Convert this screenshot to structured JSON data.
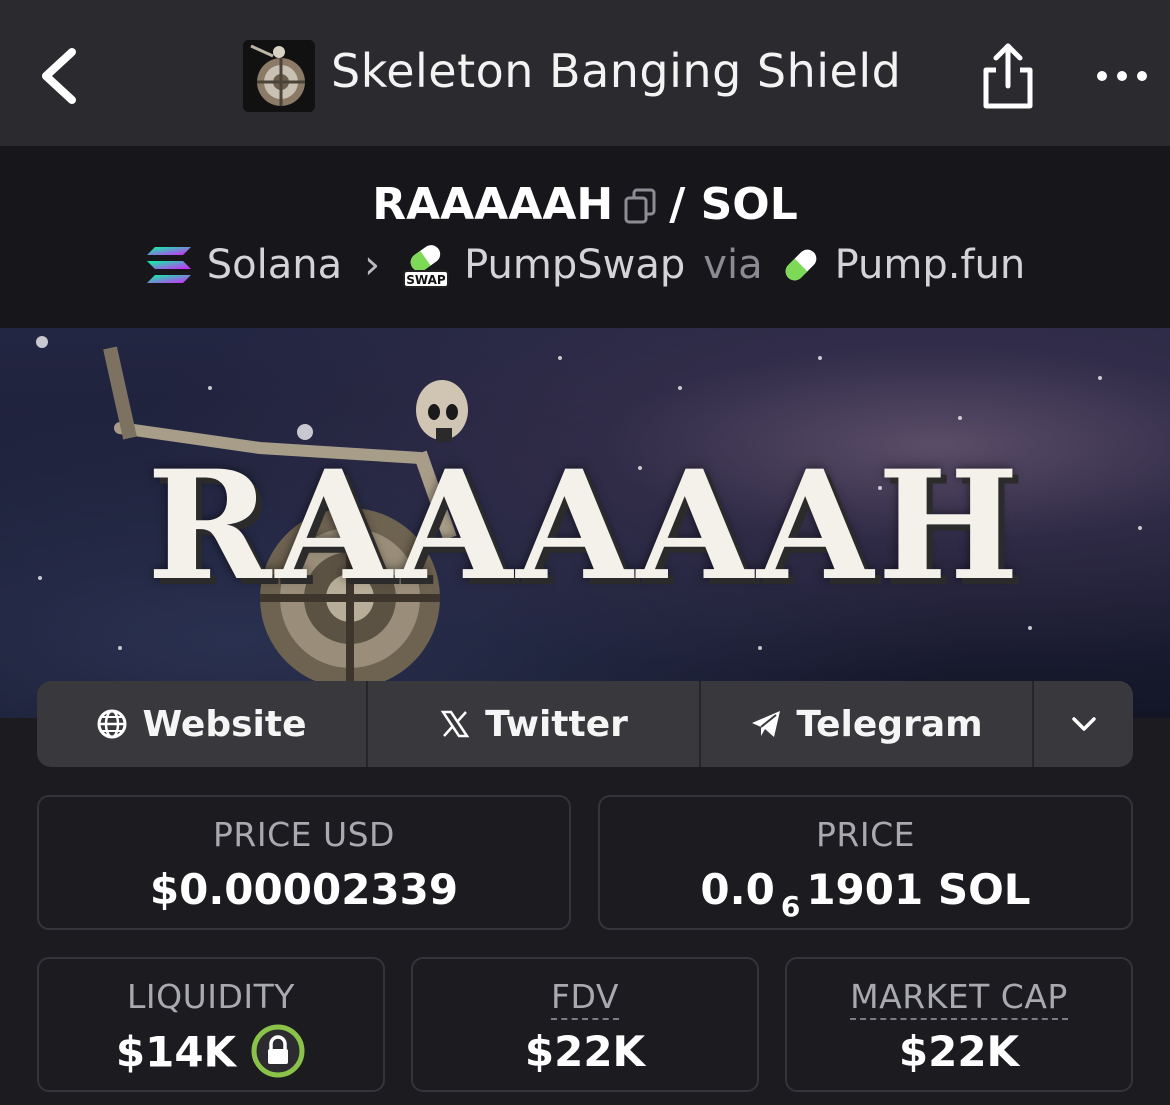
{
  "nav": {
    "title": "Skeleton Banging Shield",
    "back_icon": "chevron-left-icon",
    "share_icon": "share-icon",
    "more_icon": "more-horizontal-icon"
  },
  "pair": {
    "base": "RAAAAAH",
    "separator": "/",
    "quote": "SOL",
    "chain": "Solana",
    "dex": "PumpSwap",
    "via": "via",
    "launchpad": "Pump.fun",
    "dex_badge": "SWAP"
  },
  "banner": {
    "text": "RAAAAAH"
  },
  "links": [
    {
      "label": "Website",
      "icon": "globe-icon"
    },
    {
      "label": "Twitter",
      "icon": "x-icon"
    },
    {
      "label": "Telegram",
      "icon": "telegram-icon"
    }
  ],
  "stats": {
    "price_usd": {
      "label": "PRICE USD",
      "value": "$0.00002339"
    },
    "price": {
      "label": "PRICE",
      "prefix": "0.0",
      "zeros": "6",
      "digits": "1901",
      "unit": "SOL"
    },
    "liquidity": {
      "label": "LIQUIDITY",
      "value": "$14K",
      "locked": true
    },
    "fdv": {
      "label": "FDV",
      "value": "$22K"
    },
    "market_cap": {
      "label": "MARKET CAP",
      "value": "$22K"
    }
  },
  "colors": {
    "background": "#1b1b20",
    "topbar": "#2a2a2f",
    "lock_ring": "#8bc34a",
    "pump_green": "#7ed957"
  }
}
